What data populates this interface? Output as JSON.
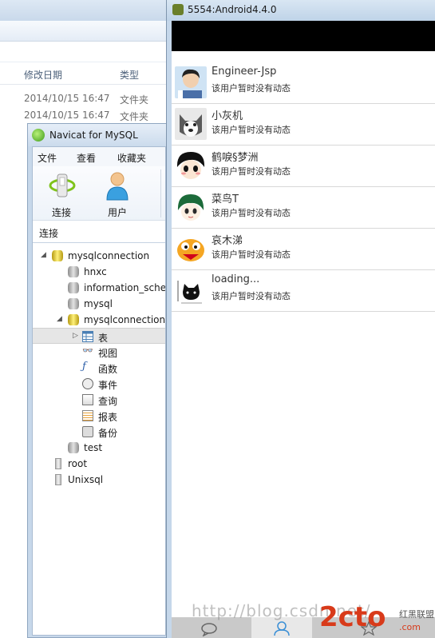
{
  "explorer": {
    "col_date": "修改日期",
    "col_type": "类型",
    "rows": [
      {
        "date": "2014/10/15 16:47",
        "type": "文件夹"
      },
      {
        "date": "2014/10/15 16:47",
        "type": "文件夹"
      }
    ]
  },
  "navicat": {
    "title": "Navicat for MySQL",
    "menu": [
      "文件",
      "查看",
      "收藏夹"
    ],
    "tools": [
      {
        "label": "连接",
        "icon": "connection-icon"
      },
      {
        "label": "用户",
        "icon": "user-icon"
      }
    ],
    "tab": "连接",
    "tree": {
      "root_connection": "mysqlconnection",
      "databases": [
        "hnxc",
        "information_schema",
        "mysql",
        "mysqlconnection"
      ],
      "objects": [
        "表",
        "视图",
        "函数",
        "事件",
        "查询",
        "报表",
        "备份"
      ],
      "extra_db": "test",
      "other_connections": [
        "root",
        "Unixsql"
      ]
    }
  },
  "android": {
    "title": "5554:Android4.4.0",
    "friends": [
      {
        "name": "Engineer-Jsp",
        "status": "该用户暂时没有动态",
        "avatar": "boy"
      },
      {
        "name": "小灰机",
        "status": "该用户暂时没有动态",
        "avatar": "husky"
      },
      {
        "name": "鹤唳§梦洲",
        "status": "该用户暂时没有动态",
        "avatar": "cartoon-black-hair"
      },
      {
        "name": "菜鸟T",
        "status": "该用户暂时没有动态",
        "avatar": "cartoon-green-hair"
      },
      {
        "name": "哀木涕",
        "status": "该用户暂时没有动态",
        "avatar": "cartoon-bird"
      },
      {
        "name": "loading...",
        "status": "该用户暂时没有动态",
        "avatar": "cat-drawing"
      }
    ]
  },
  "watermark": {
    "url_text": "http://blog.csdn.net/",
    "logo": "2cto",
    "sub1": "红黑联盟",
    "sub2": ".com"
  }
}
